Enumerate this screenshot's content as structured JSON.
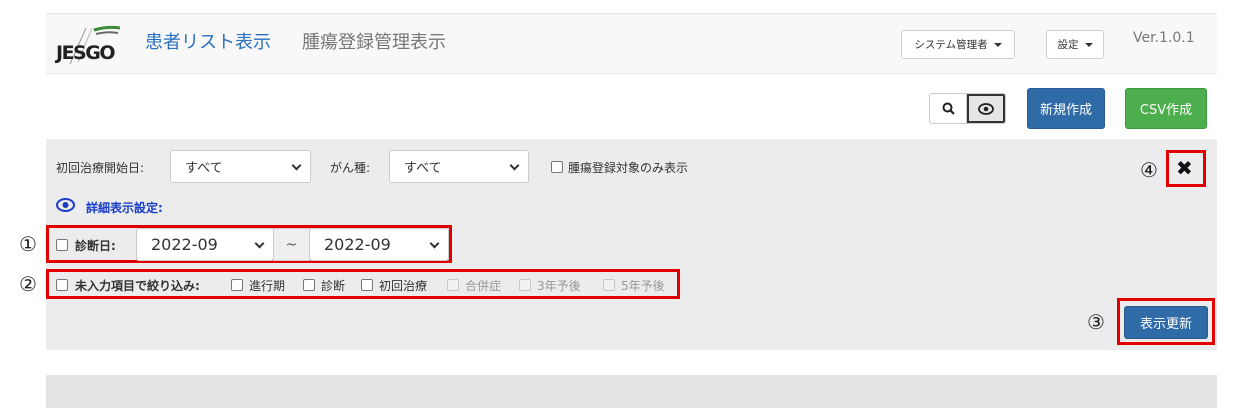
{
  "navbar": {
    "logo_text": "JESGO",
    "link_active": "患者リスト表示",
    "link": "腫瘍登録管理表示",
    "user_menu": "システム管理者",
    "settings_menu": "設定",
    "version": "Ver.1.0.1"
  },
  "toolbar": {
    "new_label": "新規作成",
    "csv_label": "CSV作成",
    "search_icon": "search-icon",
    "eye_icon": "eye-icon"
  },
  "filters": {
    "first_treatment_label": "初回治療開始日:",
    "first_treatment_value": "すべて",
    "cancer_type_label": "がん種:",
    "cancer_type_value": "すべて",
    "tumor_only_label": "腫瘍登録対象のみ表示",
    "detail_settings_label": "詳細表示設定:",
    "diagnosis_date_label": "診断日:",
    "diagnosis_from": "2022-09",
    "range_sep": "~",
    "diagnosis_to": "2022-09",
    "incomplete_label": "未入力項目で絞り込み:",
    "opt_progress": "進行期",
    "opt_diagnosis": "診断",
    "opt_first_treatment": "初回治療",
    "opt_complication": "合併症",
    "opt_3yr": "3年予後",
    "opt_5yr": "5年予後",
    "refresh_label": "表示更新"
  },
  "annotations": {
    "n1": "①",
    "n2": "②",
    "n3": "③",
    "n4": "④",
    "close_glyph": "✖"
  },
  "colors": {
    "brand": "#2a6fc0",
    "primary": "#2f6ca7",
    "success": "#4cae4c",
    "highlight": "#e00000"
  }
}
